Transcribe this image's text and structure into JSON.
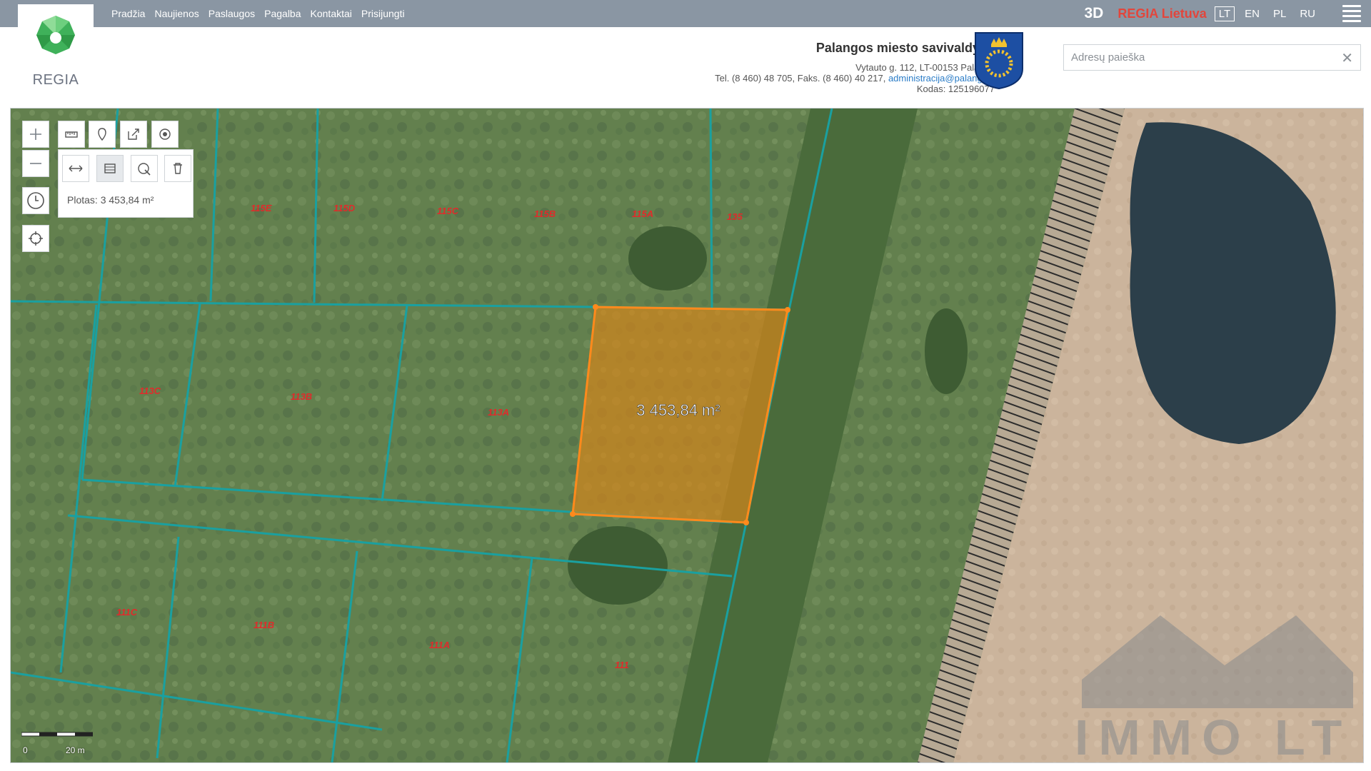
{
  "nav": {
    "links": [
      "Pradžia",
      "Naujienos",
      "Paslaugos",
      "Pagalba",
      "Kontaktai",
      "Prisijungti"
    ],
    "btn_3d": "3D",
    "regia_lietuva": "REGIA Lietuva",
    "languages": [
      "LT",
      "EN",
      "PL",
      "RU"
    ],
    "active_language": "LT"
  },
  "logo": {
    "text": "REGIA"
  },
  "municipality": {
    "title": "Palangos miesto savivaldybė",
    "address": "Vytauto g. 112, LT-00153 Palanga",
    "phone_prefix": "Tel. (8 460) 48 705, Faks. (8 460) 40 217, ",
    "email": "administracija@palanga.lt",
    "code": "Kodas: 125196077"
  },
  "search": {
    "placeholder": "Adresų paieška",
    "value": ""
  },
  "map": {
    "area_panel_label": "Plotas: 3 453,84 m²",
    "polygon_label": "3 453,84 m²",
    "parcel_labels": [
      "115E",
      "115D",
      "115C",
      "115B",
      "115A",
      "135",
      "113C",
      "113B",
      "113A",
      "111C",
      "111B",
      "111A",
      "111"
    ],
    "scale_labels": [
      "0",
      "20 m"
    ],
    "watermark": "IMMO LT"
  },
  "colors": {
    "topbar": "#8a96a3",
    "accent_red": "#e2463c",
    "parcel_line": "#1aa0a0",
    "polygon_stroke": "#ff8a1c",
    "polygon_fill": "#d4861b",
    "parcel_label": "#e02b2b",
    "link_blue": "#2a7cc7"
  },
  "icons": [
    "plus-icon",
    "minus-icon",
    "clock-icon",
    "locate-icon",
    "measure-icon",
    "marker-icon",
    "share-icon",
    "target-icon",
    "distance-icon",
    "area-icon",
    "select-icon",
    "trash-icon",
    "hamburger-icon",
    "close-icon"
  ]
}
